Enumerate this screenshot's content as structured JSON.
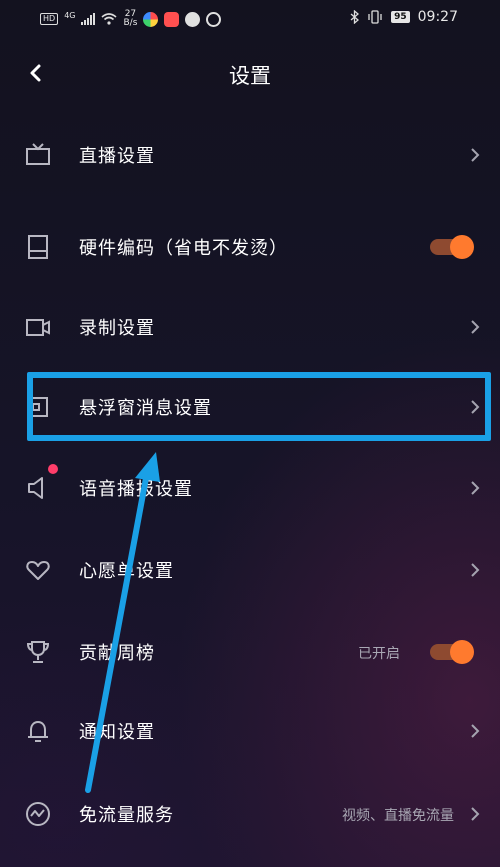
{
  "status_bar": {
    "network": "HD",
    "signal_type": "4G",
    "speed_value": "27",
    "speed_unit": "B/s",
    "battery": "95",
    "time": "09:27"
  },
  "header": {
    "title": "设置",
    "back_icon": "chevron-left-icon"
  },
  "settings": {
    "live": {
      "label": "直播设置",
      "icon": "tv-icon"
    },
    "hw_encoding": {
      "label": "硬件编码（省电不发烫）",
      "icon": "device-icon",
      "toggle_on": true
    },
    "record": {
      "label": "录制设置",
      "icon": "video-camera-icon"
    },
    "float_window": {
      "label": "悬浮窗消息设置",
      "icon": "floating-window-icon"
    },
    "voice": {
      "label": "语音播报设置",
      "icon": "speaker-icon",
      "has_dot": true
    },
    "wishlist": {
      "label": "心愿单设置",
      "icon": "heart-icon"
    },
    "contribution": {
      "label": "贡献周榜",
      "icon": "trophy-icon",
      "value": "已开启",
      "toggle_on": true
    },
    "notification": {
      "label": "通知设置",
      "icon": "bell-icon"
    },
    "free_data": {
      "label": "免流量服务",
      "icon": "pulse-icon",
      "value": "视频、直播免流量"
    }
  },
  "colors": {
    "accent": "#ff7a2e",
    "highlight": "#1aa0e6",
    "badge": "#ff3d6a"
  }
}
